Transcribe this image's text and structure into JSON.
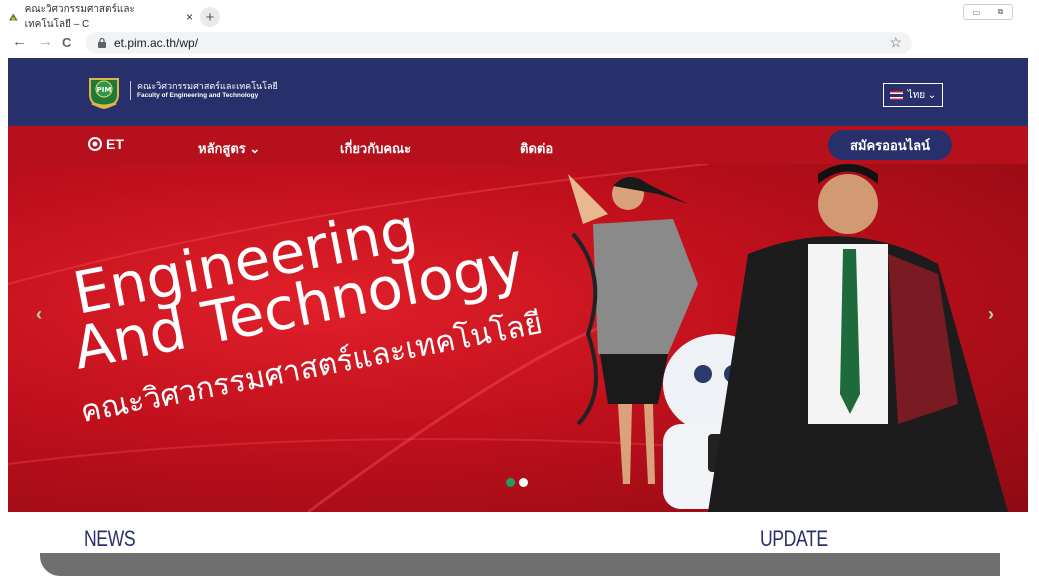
{
  "browser": {
    "tab_title": "คณะวิศวกรรมศาสตร์และเทคโนโลยี – C",
    "tab_close": "×",
    "new_tab": "+",
    "url": "et.pim.ac.th/wp/",
    "back": "←",
    "forward": "→",
    "reload": "C",
    "bookmark": "☆"
  },
  "header": {
    "logo_text": "PIM",
    "brand_th": "คณะวิศวกรรมศาสตร์และเทคโนโลยี",
    "brand_en": "Faculty of Engineering and Technology",
    "lang_label": "ไทย ⌄"
  },
  "menu": {
    "et_label": "ET",
    "items": [
      "หลักสูตร ⌄",
      "เกี่ยวกับคณะ",
      "ติดต่อ"
    ],
    "apply_label": "สมัครออนไลน์"
  },
  "hero": {
    "line1": "Engineering",
    "line2": "And Technology",
    "line3": "คณะวิศวกรรมศาสตร์และเทคโนโลยี",
    "prev": "‹",
    "next": "›",
    "slides_total": 2,
    "slide_active": 1,
    "colors": {
      "dot_active": "#1e9e5a",
      "dot_inactive": "#ffffff",
      "arrow": "#9fe0b0"
    }
  },
  "sections": {
    "news": "NEWS",
    "update": "UPDATE"
  },
  "colors": {
    "navy": "#27306b",
    "red": "#b7101d"
  }
}
